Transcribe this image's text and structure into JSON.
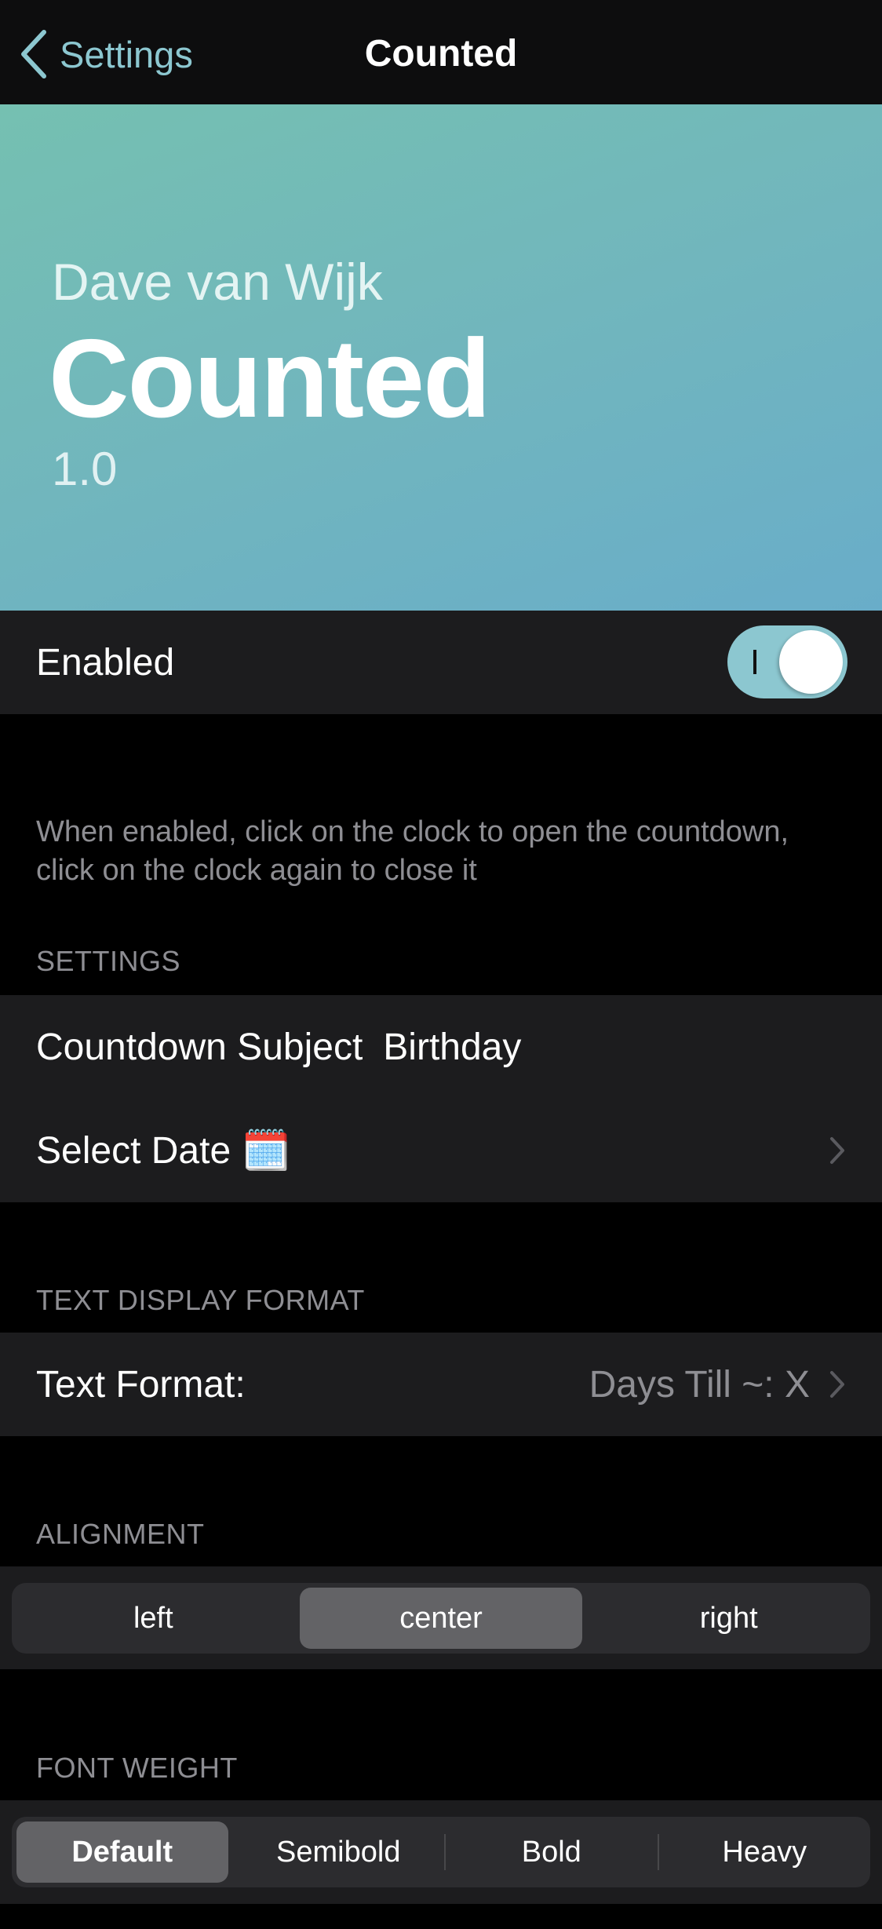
{
  "navbar": {
    "back_label": "Settings",
    "title": "Counted",
    "accent_color": "#8cc7d0"
  },
  "banner": {
    "author": "Dave van Wijk",
    "name": "Counted",
    "version": "1.0",
    "gradient_colors": [
      "#75c0b1",
      "#69adc9"
    ]
  },
  "enabled": {
    "label": "Enabled",
    "value": true,
    "footer": "When enabled, click on the clock to open the countdown, click on the clock again to close it"
  },
  "settings": {
    "header": "SETTINGS",
    "countdown_subject_label": "Countdown Subject",
    "countdown_subject_value": "Birthday",
    "select_date_label": "Select Date",
    "select_date_icon": "🗓️"
  },
  "text_display": {
    "header": "TEXT DISPLAY FORMAT",
    "label": "Text Format:",
    "value": "Days Till ~: X"
  },
  "alignment": {
    "header": "ALIGNMENT",
    "options": [
      "left",
      "center",
      "right"
    ],
    "selected": "center"
  },
  "font_weight": {
    "header": "FONT WEIGHT",
    "options": [
      "Default",
      "Semibold",
      "Bold",
      "Heavy"
    ],
    "selected": "Default"
  }
}
